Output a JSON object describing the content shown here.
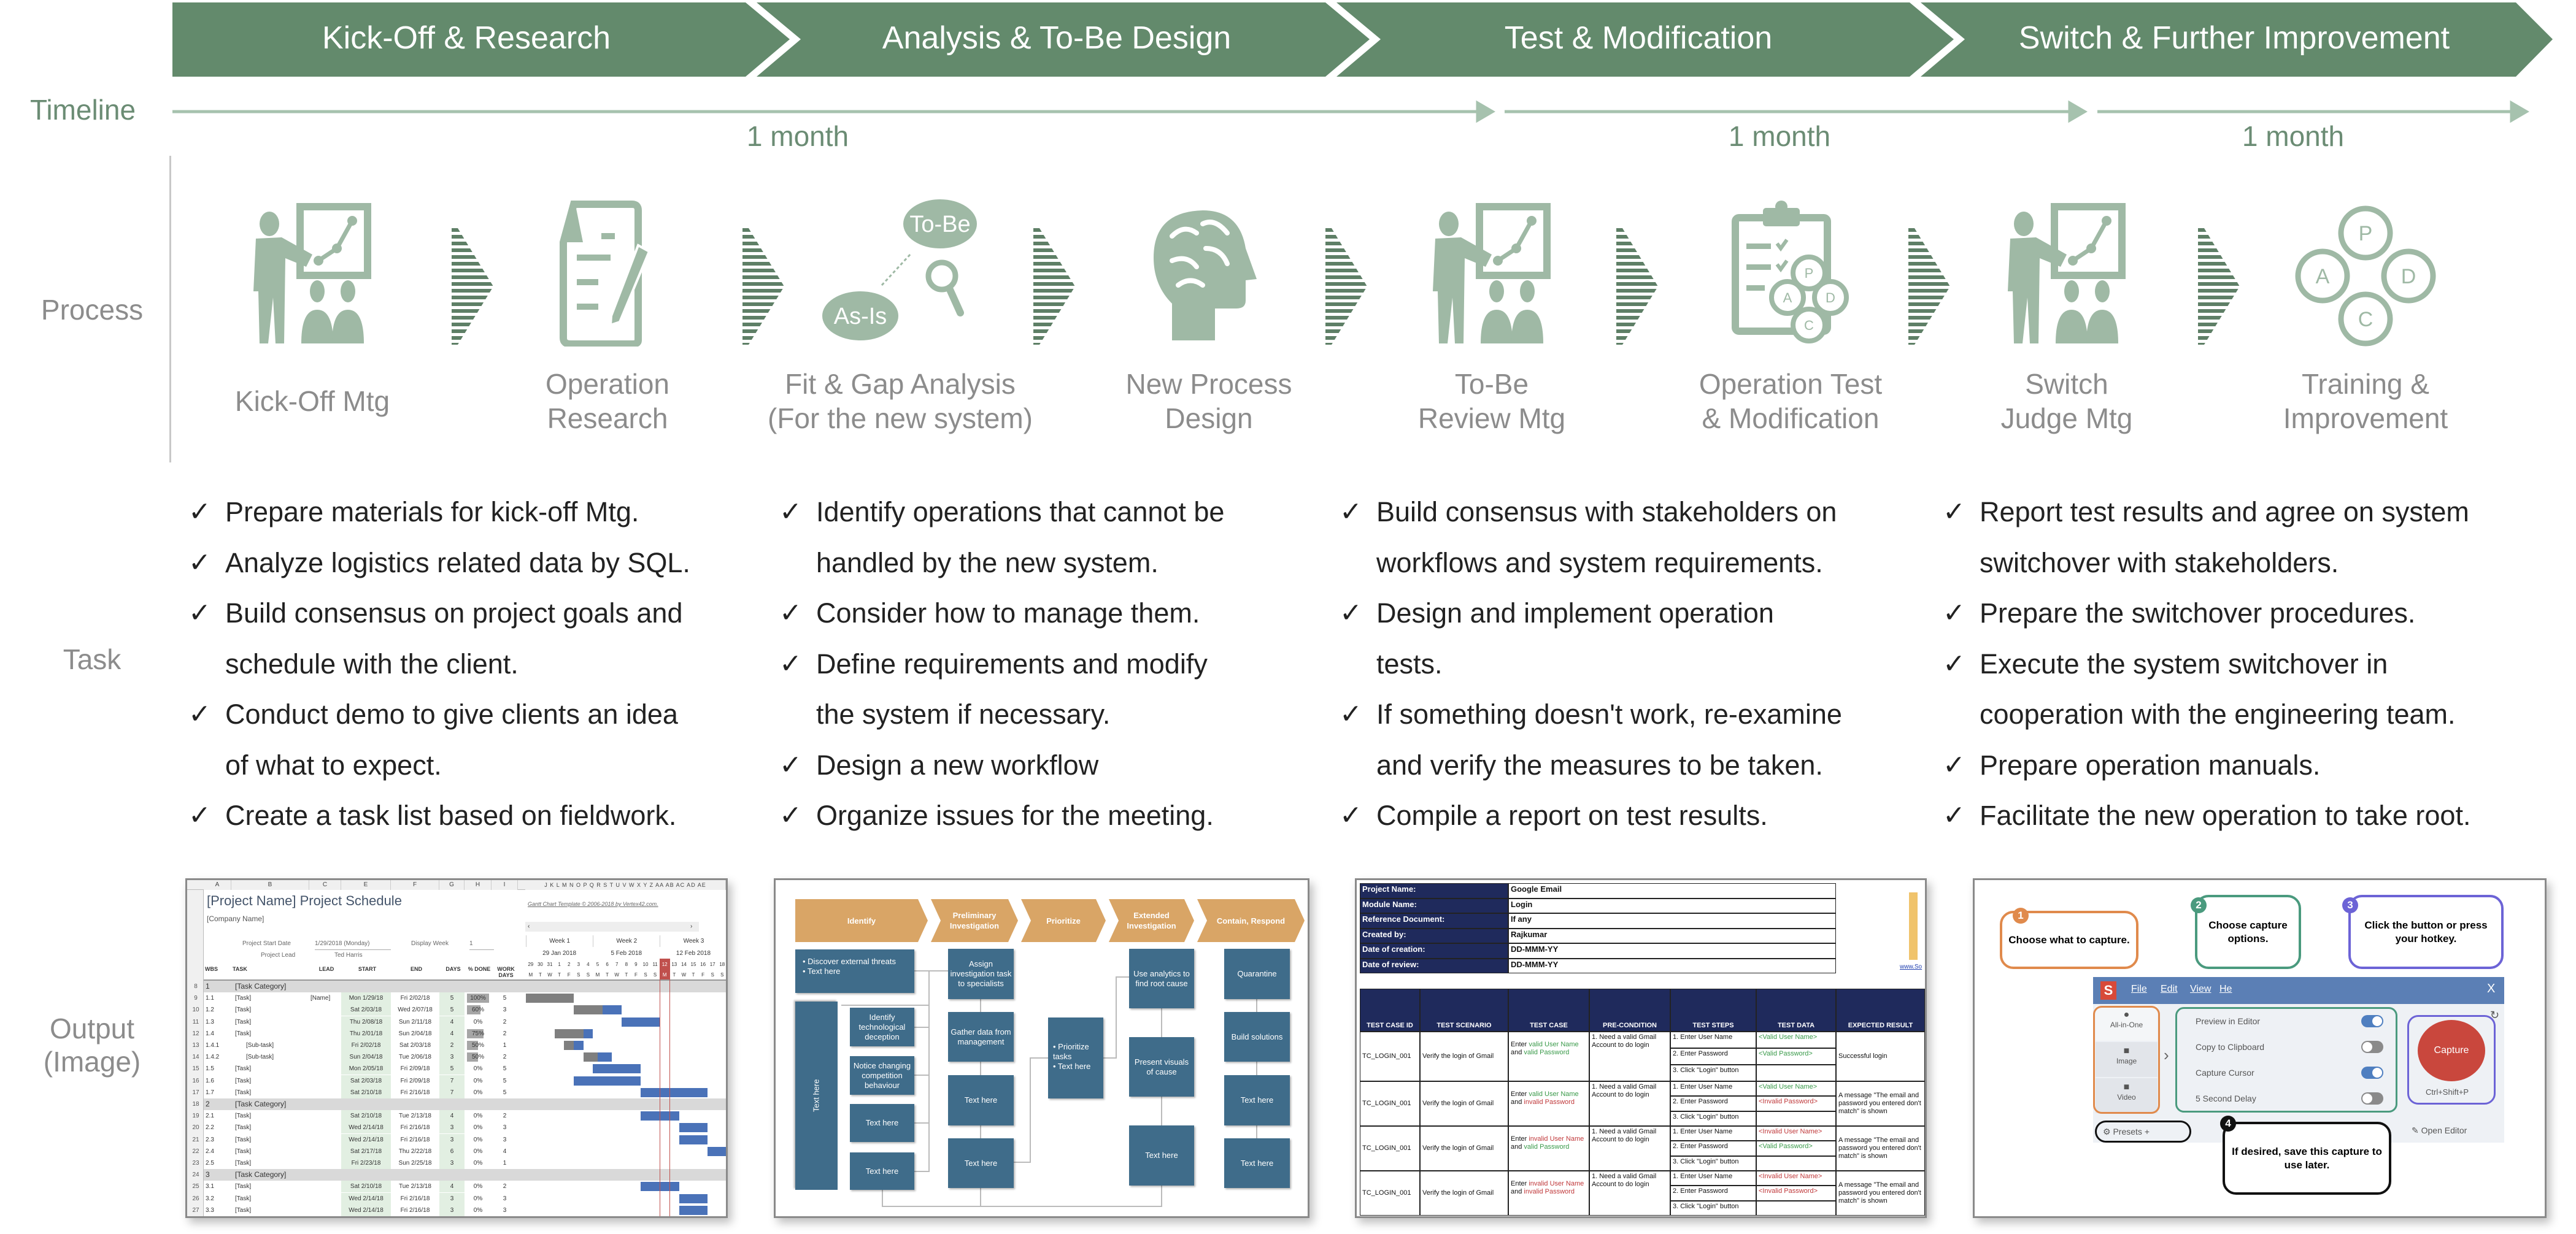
{
  "colors": {
    "header": "#638a6c",
    "icon": "#9fb9a5",
    "stripe": "#5e7f66",
    "timeline": "#a6c2ae",
    "label": "#8c8c8c"
  },
  "header": {
    "phases": [
      "Kick-Off & Research",
      "Analysis & To-Be Design",
      "Test & Modification",
      "Switch & Further Improvement"
    ]
  },
  "rows": {
    "timeline": "Timeline",
    "process": "Process",
    "task": "Task",
    "output_line1": "Output",
    "output_line2": "(Image)"
  },
  "timeline": {
    "durations": [
      "1 month",
      "1 month",
      "1 month"
    ]
  },
  "process": {
    "steps": [
      {
        "icon": "presenter-icon",
        "line1": "",
        "line2": "Kick-Off Mtg"
      },
      {
        "icon": "document-pencil-icon",
        "line1": "Operation",
        "line2": "Research"
      },
      {
        "icon": "fit-gap-icon",
        "line1": "Fit & Gap Analysis",
        "line2": "(For the new system)"
      },
      {
        "icon": "brain-head-icon",
        "line1": "New Process",
        "line2": "Design"
      },
      {
        "icon": "presenter-icon",
        "line1": "To-Be",
        "line2": "Review Mtg"
      },
      {
        "icon": "clipboard-pdca-icon",
        "line1": "Operation Test",
        "line2": "& Modification"
      },
      {
        "icon": "presenter-icon",
        "line1": "Switch",
        "line2": "Judge Mtg"
      },
      {
        "icon": "pdca-cycle-icon",
        "line1": "Training &",
        "line2": "Improvement"
      }
    ],
    "tobe": "To-Be",
    "asis": "As-Is",
    "pdca": {
      "p": "P",
      "d": "D",
      "c": "C",
      "a": "A"
    }
  },
  "tasks": {
    "check_icon": "checkmark-icon",
    "check": "✓",
    "columns": [
      [
        [
          "Prepare materials for kick-off Mtg."
        ],
        [
          "Analyze logistics related data by SQL."
        ],
        [
          "Build consensus on project goals and",
          "schedule with the client."
        ],
        [
          "Conduct demo to give clients an idea",
          "of what to expect."
        ],
        [
          "Create a task list based on fieldwork."
        ]
      ],
      [
        [
          "Identify operations that cannot be",
          "handled by the new system."
        ],
        [
          "Consider how to manage them."
        ],
        [
          "Define requirements and modify",
          "the system if necessary."
        ],
        [
          "Design a new workflow"
        ],
        [
          "Organize issues for the meeting."
        ]
      ],
      [
        [
          "Build consensus with stakeholders on",
          "workflows and system requirements."
        ],
        [
          "Design and implement operation",
          "tests."
        ],
        [
          "If something doesn't work, re-examine",
          "and verify the measures to be taken."
        ],
        [
          "Compile a report on test results."
        ]
      ],
      [
        [
          "Report test results and agree on system",
          "switchover with stakeholders."
        ],
        [
          "Prepare the switchover procedures."
        ],
        [
          "Execute the system switchover in",
          "cooperation with the engineering team."
        ],
        [
          "Prepare operation manuals."
        ],
        [
          "Facilitate the new operation to take root."
        ]
      ]
    ]
  },
  "outputs": {
    "gantt": {
      "col_letters": [
        "A",
        "B",
        "C",
        "E",
        "F",
        "G",
        "H",
        "I"
      ],
      "day_col_letters": "J K L M N O P Q R S T U V W X Y Z AA AB AC AD AE",
      "title": "[Project Name] Project Schedule",
      "company": "[Company Name]",
      "template_credit": "Gantt Chart Template  © 2006-2018 by Vertex42.com.",
      "start_date_label": "Project Start Date",
      "start_date": "1/29/2018 (Monday)",
      "display_week_label": "Display Week",
      "display_week": "1",
      "lead_label": "Project Lead",
      "lead": "Ted Harris",
      "weeks": [
        {
          "name": "Week 1",
          "date": "29 Jan 2018"
        },
        {
          "name": "Week 2",
          "date": "5 Feb 2018"
        },
        {
          "name": "Week 3",
          "date": "12 Feb 2018"
        }
      ],
      "days": [
        "29",
        "30",
        "31",
        "1",
        "2",
        "3",
        "4",
        "5",
        "6",
        "7",
        "8",
        "9",
        "10",
        "11",
        "12",
        "13",
        "14",
        "15",
        "16",
        "17",
        "18"
      ],
      "weekdays": [
        "M",
        "T",
        "W",
        "T",
        "F",
        "S",
        "S",
        "M",
        "T",
        "W",
        "T",
        "F",
        "S",
        "S",
        "M",
        "T",
        "W",
        "T",
        "F",
        "S",
        "S"
      ],
      "today_index": 14,
      "headers": [
        "WBS",
        "TASK",
        "LEAD",
        "START",
        "END",
        "DAYS",
        "% DONE",
        "WORK DAYS"
      ],
      "rows": [
        {
          "n": "8",
          "wbs": "1",
          "task": "[Task Category]",
          "cat": true
        },
        {
          "n": "9",
          "wbs": "1.1",
          "task": "[Task]",
          "lead": "[Name]",
          "start": "Mon 1/29/18",
          "end": "Fri 2/02/18",
          "days": "5",
          "done": "100%",
          "work": "5"
        },
        {
          "n": "10",
          "wbs": "1.2",
          "task": "[Task]",
          "start": "Sat 2/03/18",
          "end": "Wed 2/07/18",
          "days": "5",
          "done": "60%",
          "work": "3"
        },
        {
          "n": "11",
          "wbs": "1.3",
          "task": "[Task]",
          "start": "Thu 2/08/18",
          "end": "Sun 2/11/18",
          "days": "4",
          "done": "0%",
          "work": "2"
        },
        {
          "n": "12",
          "wbs": "1.4",
          "task": "[Task]",
          "start": "Thu 2/01/18",
          "end": "Sun 2/04/18",
          "days": "4",
          "done": "75%",
          "work": "2"
        },
        {
          "n": "13",
          "wbs": "1.4.1",
          "task": "[Sub-task]",
          "sub": true,
          "start": "Fri 2/02/18",
          "end": "Sat 2/03/18",
          "days": "2",
          "done": "50%",
          "work": "1"
        },
        {
          "n": "14",
          "wbs": "1.4.2",
          "task": "[Sub-task]",
          "sub": true,
          "start": "Sun 2/04/18",
          "end": "Tue 2/06/18",
          "days": "3",
          "done": "50%",
          "work": "2"
        },
        {
          "n": "15",
          "wbs": "1.5",
          "task": "[Task]",
          "start": "Mon 2/05/18",
          "end": "Fri 2/09/18",
          "days": "5",
          "done": "0%",
          "work": "5"
        },
        {
          "n": "16",
          "wbs": "1.6",
          "task": "[Task]",
          "start": "Sat 2/03/18",
          "end": "Fri 2/09/18",
          "days": "7",
          "done": "0%",
          "work": "5"
        },
        {
          "n": "17",
          "wbs": "1.7",
          "task": "[Task]",
          "start": "Sat 2/10/18",
          "end": "Fri 2/16/18",
          "days": "7",
          "done": "0%",
          "work": "5"
        },
        {
          "n": "18",
          "wbs": "2",
          "task": "[Task Category]",
          "cat": true
        },
        {
          "n": "19",
          "wbs": "2.1",
          "task": "[Task]",
          "start": "Sat 2/10/18",
          "end": "Tue 2/13/18",
          "days": "4",
          "done": "0%",
          "work": "2"
        },
        {
          "n": "20",
          "wbs": "2.2",
          "task": "[Task]",
          "start": "Wed 2/14/18",
          "end": "Fri 2/16/18",
          "days": "3",
          "done": "0%",
          "work": "3"
        },
        {
          "n": "21",
          "wbs": "2.3",
          "task": "[Task]",
          "start": "Wed 2/14/18",
          "end": "Fri 2/16/18",
          "days": "3",
          "done": "0%",
          "work": "3"
        },
        {
          "n": "22",
          "wbs": "2.4",
          "task": "[Task]",
          "start": "Sat 2/17/18",
          "end": "Thu 2/22/18",
          "days": "6",
          "done": "0%",
          "work": "4"
        },
        {
          "n": "23",
          "wbs": "2.5",
          "task": "[Task]",
          "start": "Fri 2/23/18",
          "end": "Sun 2/25/18",
          "days": "3",
          "done": "0%",
          "work": "1"
        },
        {
          "n": "24",
          "wbs": "3",
          "task": "[Task Category]",
          "cat": true
        },
        {
          "n": "25",
          "wbs": "3.1",
          "task": "[Task]",
          "start": "Sat 2/10/18",
          "end": "Tue 2/13/18",
          "days": "4",
          "done": "0%",
          "work": "2"
        },
        {
          "n": "26",
          "wbs": "3.2",
          "task": "[Task]",
          "start": "Wed 2/14/18",
          "end": "Fri 2/16/18",
          "days": "3",
          "done": "0%",
          "work": "3"
        },
        {
          "n": "27",
          "wbs": "3.3",
          "task": "[Task]",
          "start": "Wed 2/14/18",
          "end": "Fri 2/16/18",
          "days": "3",
          "done": "0%",
          "work": "3"
        }
      ]
    },
    "flowchart": {
      "stages": [
        "Identify",
        "Preliminary Investigation",
        "Prioritize",
        "Extended Investigation",
        "Contain, Respond"
      ],
      "discover": [
        "Discover external threats",
        "Text here"
      ],
      "vertical": "Text here",
      "left": [
        "Identify technological deception",
        "Notice changing competition behaviour",
        "Text here",
        "Text here"
      ],
      "col2": [
        "Assign investigation task to specialists",
        "Gather data from management",
        "Text here",
        "Text here"
      ],
      "prioritize": [
        "Prioritize tasks",
        "Text here"
      ],
      "col4": [
        "Use analytics to find root cause",
        "Present visuals of cause",
        "Text here"
      ],
      "col5": [
        "Quarantine",
        "Build solutions",
        "Text here",
        "Text here"
      ],
      "stage_color": "#d9a566",
      "box_color": "#3f6c8a"
    },
    "testcase": {
      "info": [
        [
          "Project Name:",
          "Google Email"
        ],
        [
          "Module Name:",
          "Login"
        ],
        [
          "Reference Document:",
          "If any"
        ],
        [
          "Created by:",
          "Rajkumar"
        ],
        [
          "Date of creation:",
          "DD-MMM-YY"
        ],
        [
          "Date of review:",
          "DD-MMM-YY"
        ]
      ],
      "link": "www.So",
      "headers": [
        "TEST CASE ID",
        "TEST SCENARIO",
        "TEST CASE",
        "PRE-CONDITION",
        "TEST STEPS",
        "TEST DATA",
        "EXPECTED RESULT"
      ],
      "steps": [
        "1. Enter User Name",
        "2. Enter Password",
        "3. Click \"Login\" button"
      ],
      "rows": [
        {
          "id": "TC_LOGIN_001",
          "scenario": "Verify the login of Gmail",
          "case": [
            [
              "Enter ",
              ""
            ],
            [
              "valid User Name",
              "g"
            ],
            [
              " and ",
              ""
            ],
            [
              "valid Password",
              "g"
            ]
          ],
          "pre": "1. Need a valid Gmail Account to do login",
          "data": [
            [
              "<Valid User Name>",
              "g"
            ],
            [
              "<Valid Password>",
              "g"
            ]
          ],
          "result": "Successful login"
        },
        {
          "id": "TC_LOGIN_001",
          "scenario": "Verify the login of Gmail",
          "case": [
            [
              "Enter ",
              ""
            ],
            [
              "valid User Name",
              "g"
            ],
            [
              " and ",
              ""
            ],
            [
              "invalid Password",
              "r"
            ]
          ],
          "pre": "1. Need a valid Gmail Account to do login",
          "data": [
            [
              "<Valid User Name>",
              "g"
            ],
            [
              "<Invalid Password>",
              "r"
            ]
          ],
          "result": "A message \"The email and password you entered don't match\" is shown"
        },
        {
          "id": "TC_LOGIN_001",
          "scenario": "Verify the login of Gmail",
          "case": [
            [
              "Enter ",
              ""
            ],
            [
              "invalid User Name",
              "r"
            ],
            [
              " and ",
              ""
            ],
            [
              "valid Password",
              "g"
            ]
          ],
          "pre": "1. Need a valid Gmail Account to do login",
          "data": [
            [
              "<Invalid User Name>",
              "r"
            ],
            [
              "<Valid Password>",
              "g"
            ]
          ],
          "result": "A message \"The email and password you entered don't match\" is shown"
        },
        {
          "id": "TC_LOGIN_001",
          "scenario": "Verify the login of Gmail",
          "case": [
            [
              "Enter ",
              ""
            ],
            [
              "invalid User Name",
              "r"
            ],
            [
              " and ",
              ""
            ],
            [
              "invalid Password",
              "r"
            ]
          ],
          "pre": "1. Need a valid Gmail Account to do login",
          "data": [
            [
              "<Invalid User Name>",
              "r"
            ],
            [
              "<Invalid Password>",
              "r"
            ]
          ],
          "result": "A message \"The email and password you entered don't match\" is shown"
        }
      ]
    },
    "snagit": {
      "callouts": [
        {
          "n": "1",
          "text": "Choose what to capture."
        },
        {
          "n": "2",
          "text": "Choose capture options."
        },
        {
          "n": "3",
          "text": "Click the button or press your hotkey."
        },
        {
          "n": "4",
          "text": "If desired, save this capture to use later."
        }
      ],
      "logo": "S",
      "menu": [
        "File",
        "Edit",
        "View",
        "He"
      ],
      "close": "X",
      "modes": [
        "All-in-One",
        "Image",
        "Video"
      ],
      "options": [
        {
          "label": "Preview in Editor",
          "on": true
        },
        {
          "label": "Copy to Clipboard",
          "on": false
        },
        {
          "label": "Capture Cursor",
          "on": true
        },
        {
          "label": "5 Second Delay",
          "on": false
        }
      ],
      "capture": "Capture",
      "hotkey": "Ctrl+Shift+P",
      "presets": "Presets",
      "plus": "+",
      "open_editor": "Open Editor"
    }
  }
}
